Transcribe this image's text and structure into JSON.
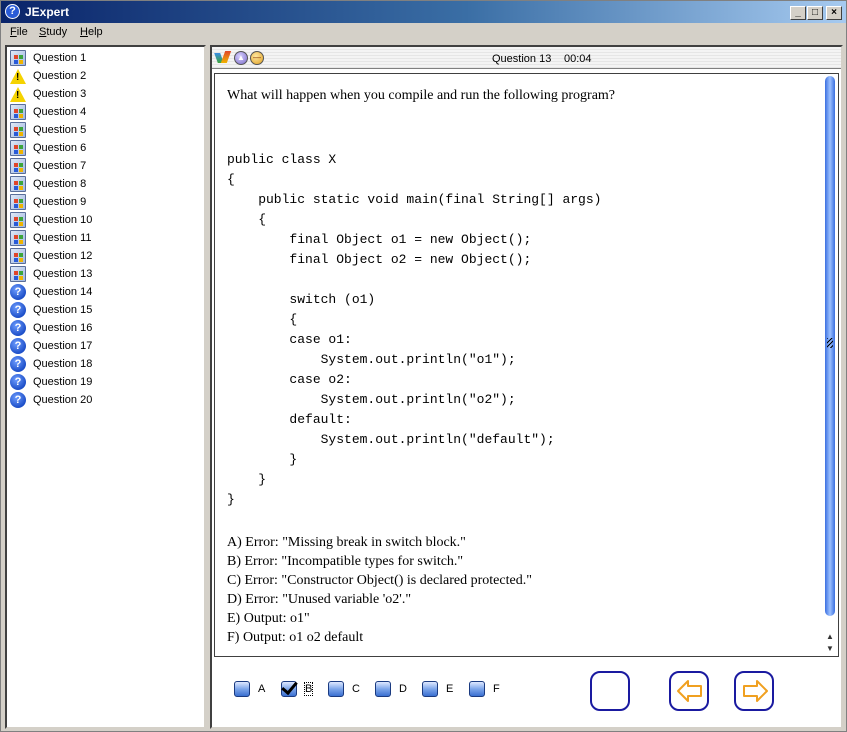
{
  "window": {
    "title": "JExpert",
    "controls": {
      "minimize": "_",
      "maximize": "□",
      "close": "×"
    }
  },
  "menu": [
    {
      "label": "File",
      "mnemonic": "F",
      "rest": "ile"
    },
    {
      "label": "Study",
      "mnemonic": "S",
      "rest": "tudy"
    },
    {
      "label": "Help",
      "mnemonic": "H",
      "rest": "elp"
    }
  ],
  "sidebar": {
    "items": [
      {
        "label": "Question 1",
        "icon": "document-icon"
      },
      {
        "label": "Question 2",
        "icon": "warning-icon"
      },
      {
        "label": "Question 3",
        "icon": "warning-icon"
      },
      {
        "label": "Question 4",
        "icon": "document-icon"
      },
      {
        "label": "Question 5",
        "icon": "document-icon"
      },
      {
        "label": "Question 6",
        "icon": "document-icon"
      },
      {
        "label": "Question 7",
        "icon": "document-icon"
      },
      {
        "label": "Question 8",
        "icon": "document-icon"
      },
      {
        "label": "Question 9",
        "icon": "document-icon"
      },
      {
        "label": "Question 10",
        "icon": "document-icon"
      },
      {
        "label": "Question 11",
        "icon": "document-icon"
      },
      {
        "label": "Question 12",
        "icon": "document-icon"
      },
      {
        "label": "Question 13",
        "icon": "document-icon"
      },
      {
        "label": "Question 14",
        "icon": "question-icon"
      },
      {
        "label": "Question 15",
        "icon": "question-icon"
      },
      {
        "label": "Question 16",
        "icon": "question-icon"
      },
      {
        "label": "Question 17",
        "icon": "question-icon"
      },
      {
        "label": "Question 18",
        "icon": "question-icon"
      },
      {
        "label": "Question 19",
        "icon": "question-icon"
      },
      {
        "label": "Question 20",
        "icon": "question-icon"
      }
    ]
  },
  "header": {
    "question_title": "Question 13",
    "timer": "00:04"
  },
  "question": {
    "prompt": "What will happen when you compile and run the following program?",
    "code": "public class X\n{\n    public static void main(final String[] args)\n    {\n        final Object o1 = new Object();\n        final Object o2 = new Object();\n\n        switch (o1)\n        {\n        case o1:\n            System.out.println(\"o1\");\n        case o2:\n            System.out.println(\"o2\");\n        default:\n            System.out.println(\"default\");\n        }\n    }\n}",
    "answers": [
      "A) Error: \"Missing break in switch block.\"",
      "B) Error: \"Incompatible types for switch.\"",
      "C) Error: \"Constructor Object() is declared protected.\"",
      "D) Error: \"Unused variable 'o2'.\"",
      "E) Output: o1\"",
      "F) Output: o1 o2 default"
    ]
  },
  "options": [
    {
      "label": "A",
      "checked": false
    },
    {
      "label": "B",
      "checked": true
    },
    {
      "label": "C",
      "checked": false
    },
    {
      "label": "D",
      "checked": false
    },
    {
      "label": "E",
      "checked": false
    },
    {
      "label": "F",
      "checked": false
    }
  ],
  "colors": {
    "nav_border": "#1a1aa0",
    "nav_arrow": "#f0a020",
    "titlebar_start": "#0a246a",
    "titlebar_end": "#a6caf0"
  }
}
